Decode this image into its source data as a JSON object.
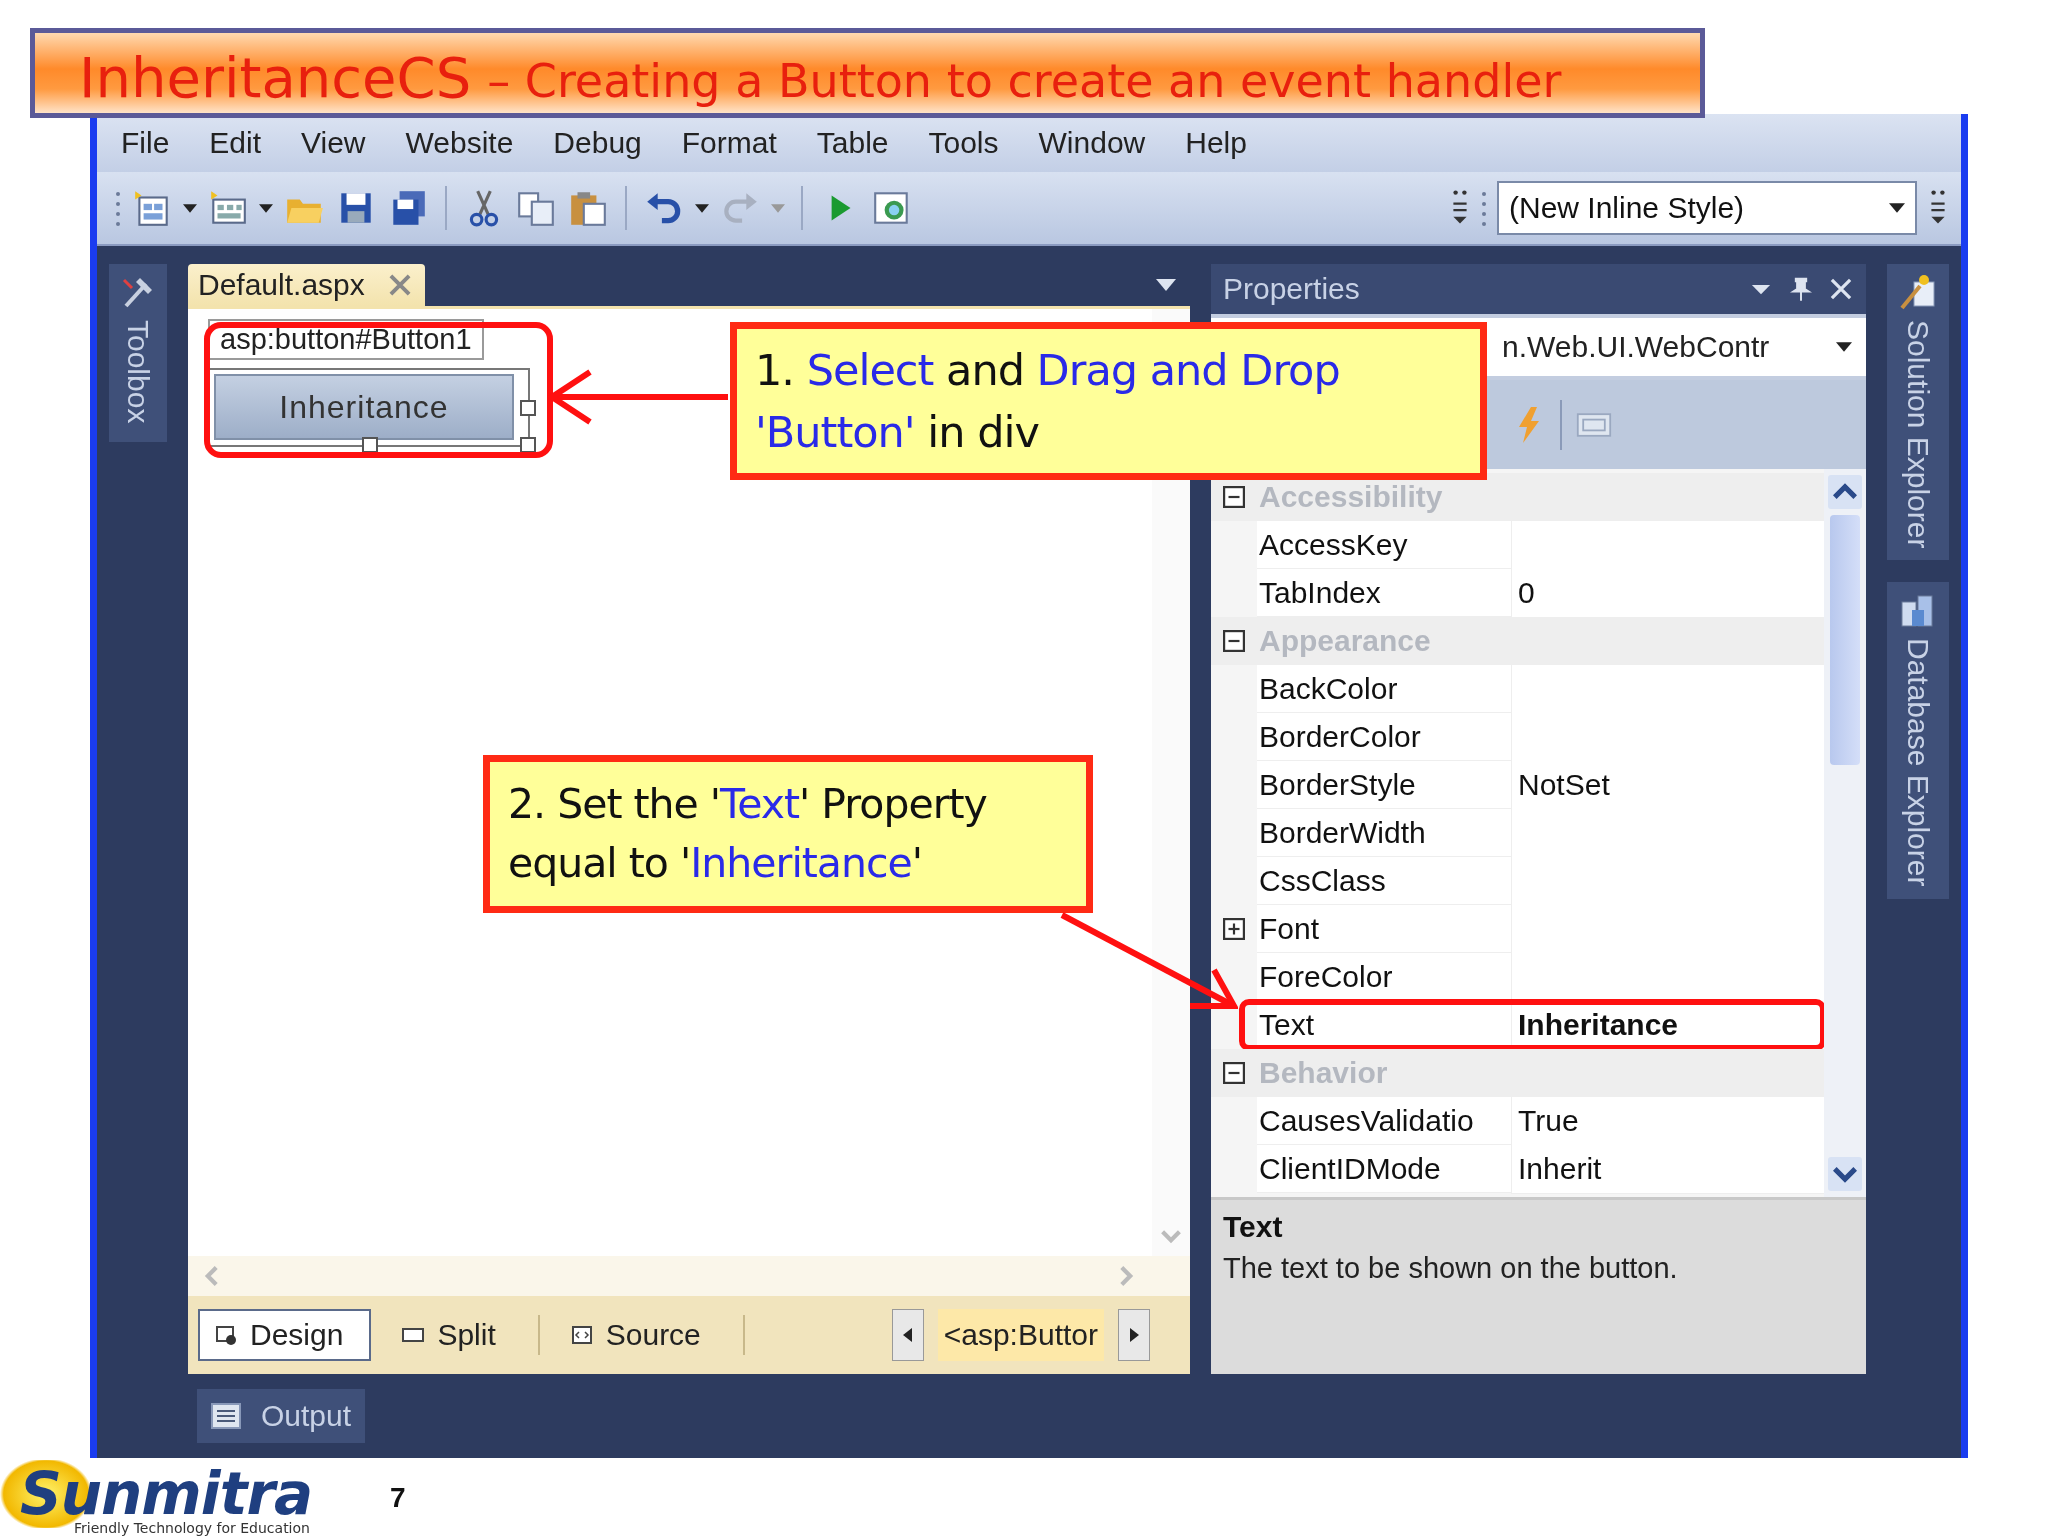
{
  "slide": {
    "title": "InheritanceCS",
    "subtitle": "– Creating a Button to create an event handler",
    "page_number": "7",
    "logo": {
      "name": "Sunmitra",
      "tagline": "Friendly Technology for Education"
    }
  },
  "ide": {
    "menu": [
      "File",
      "Edit",
      "View",
      "Website",
      "Debug",
      "Format",
      "Table",
      "Tools",
      "Window",
      "Help"
    ],
    "style_dropdown": "(New Inline Style)",
    "toolbox_tab": "Toolbox",
    "document": {
      "tab": "Default.aspx",
      "element_tag": "asp:button#Button1",
      "button_label": "Inheritance",
      "view_tabs": [
        {
          "label": "Design",
          "selected": true
        },
        {
          "label": "Split",
          "selected": false
        },
        {
          "label": "Source",
          "selected": false
        }
      ],
      "breadcrumb": "<asp:Buttor"
    },
    "properties": {
      "title": "Properties",
      "object_selector": "n.Web.UI.WebContr",
      "rows": [
        {
          "kind": "category",
          "name": "Accessibility",
          "expanded": true
        },
        {
          "kind": "property",
          "name": "AccessKey",
          "marked": false
        },
        {
          "kind": "property",
          "name": "TabIndex",
          "value": "0",
          "modified": false,
          "marked": false
        },
        {
          "kind": "category",
          "name": "Appearance",
          "expanded": true
        },
        {
          "kind": "property",
          "name": "BackColor",
          "marked": false
        },
        {
          "kind": "property",
          "name": "BorderColor",
          "marked": false
        },
        {
          "kind": "property",
          "name": "BorderStyle",
          "value": "NotSet",
          "modified": false,
          "marked": false
        },
        {
          "kind": "property",
          "name": "BorderWidth",
          "marked": false
        },
        {
          "kind": "property",
          "name": "CssClass",
          "marked": false
        },
        {
          "kind": "group",
          "name": "Font",
          "expanded": false,
          "marked": false
        },
        {
          "kind": "property",
          "name": "ForeColor",
          "marked": false
        },
        {
          "kind": "property",
          "name": "Text",
          "value": "Inheritance",
          "modified": true,
          "marked": true
        },
        {
          "kind": "category",
          "name": "Behavior",
          "expanded": true
        },
        {
          "kind": "property",
          "name": "CausesValidatio",
          "value": "True",
          "modified": false,
          "marked": false
        },
        {
          "kind": "property",
          "name": "ClientIDMode",
          "value": "Inherit",
          "modified": false,
          "marked": false
        }
      ],
      "description_title": "Text",
      "description": "The text to be shown on the button."
    },
    "side_tabs": [
      "Solution Explorer",
      "Database Explorer"
    ],
    "output_tab": "Output"
  },
  "callouts": [
    {
      "lines": [
        [
          {
            "text": "1. ",
            "highlight": false
          },
          {
            "text": "Select",
            "highlight": true
          },
          {
            "text": " and ",
            "highlight": false
          },
          {
            "text": "Drag and Drop",
            "highlight": true
          }
        ],
        [
          {
            "text": "'Button'",
            "highlight": true
          },
          {
            "text": " in div",
            "highlight": false
          }
        ]
      ]
    },
    {
      "lines": [
        [
          {
            "text": "2. Set the '",
            "highlight": false
          },
          {
            "text": "Text",
            "highlight": true
          },
          {
            "text": "' Property",
            "highlight": false
          }
        ],
        [
          {
            "text": "equal to '",
            "highlight": false
          },
          {
            "text": "Inheritance",
            "highlight": true
          },
          {
            "text": "'",
            "highlight": false
          }
        ]
      ]
    }
  ]
}
